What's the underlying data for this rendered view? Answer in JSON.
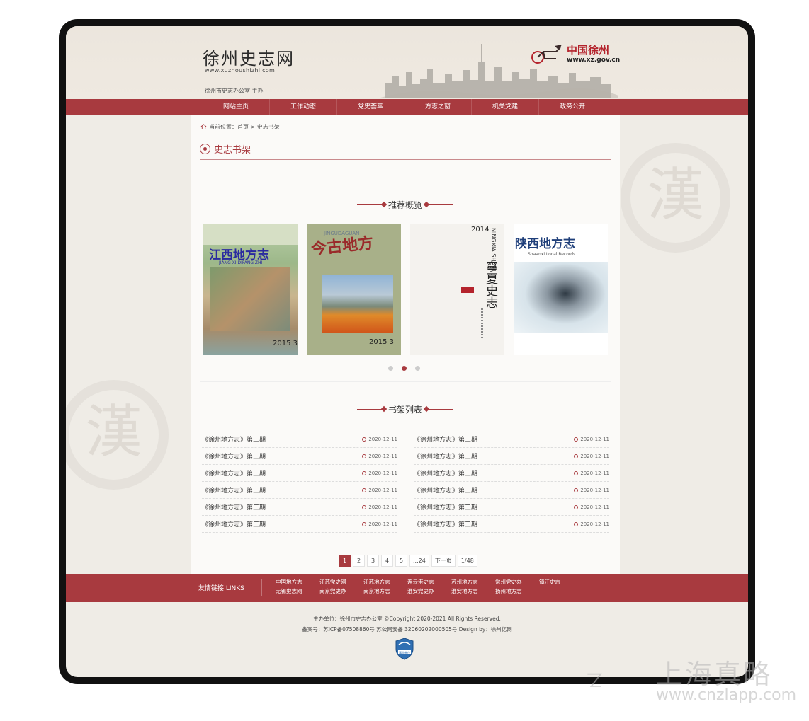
{
  "header": {
    "site_title": "徐州史志网",
    "site_url": "www.xuzhoushizhi.com",
    "host": "徐州市史志办公室 主办",
    "partner_title": "中国徐州",
    "partner_url": "www.xz.gov.cn"
  },
  "nav": [
    "网站主页",
    "工作动态",
    "党史荟萃",
    "方志之窗",
    "机关党建",
    "政务公开"
  ],
  "breadcrumb": "当前位置：首页 > 史志书架",
  "section_title": "史志书架",
  "recommend_heading": "推荐概览",
  "books": [
    {
      "title": "江西地方志",
      "subtitle": "JIANG XI DIFANG ZHI",
      "issue": "2015 3"
    },
    {
      "title": "今古地方",
      "subtitle": "JINGUDAGUAN",
      "issue": "2015 3"
    },
    {
      "title": "寧夏史志",
      "subtitle": "NINGXIA SHIZHI",
      "issue": "2014"
    },
    {
      "title": "陕西地方志",
      "subtitle": "Shaanxi Local Records",
      "issue": ""
    }
  ],
  "carousel": {
    "count": 3,
    "active": 1
  },
  "list_heading": "书架列表",
  "list_left": [
    {
      "title": "《徐州地方志》第三期",
      "date": "2020-12-11"
    },
    {
      "title": "《徐州地方志》第三期",
      "date": "2020-12-11"
    },
    {
      "title": "《徐州地方志》第三期",
      "date": "2020-12-11"
    },
    {
      "title": "《徐州地方志》第三期",
      "date": "2020-12-11"
    },
    {
      "title": "《徐州地方志》第三期",
      "date": "2020-12-11"
    },
    {
      "title": "《徐州地方志》第三期",
      "date": "2020-12-11"
    }
  ],
  "list_right": [
    {
      "title": "《徐州地方志》第三期",
      "date": "2020-12-11"
    },
    {
      "title": "《徐州地方志》第三期",
      "date": "2020-12-11"
    },
    {
      "title": "《徐州地方志》第三期",
      "date": "2020-12-11"
    },
    {
      "title": "《徐州地方志》第三期",
      "date": "2020-12-11"
    },
    {
      "title": "《徐州地方志》第三期",
      "date": "2020-12-11"
    },
    {
      "title": "《徐州地方志》第三期",
      "date": "2020-12-11"
    }
  ],
  "pager": [
    "1",
    "2",
    "3",
    "4",
    "5",
    "...24",
    "下一页",
    "1/48"
  ],
  "links_label": "友情链接 LINKS",
  "links": [
    "中国地方志",
    "江苏党史网",
    "江苏地方志",
    "连云港史志",
    "苏州地方志",
    "常州党史办",
    "镇江史志",
    "无锡史志网",
    "南京党史办",
    "南京地方志",
    "淮安党史办",
    "淮安地方志",
    "扬州地方志"
  ],
  "footer_line1": "主办单位：徐州市史志办公室 ©Copyright 2020-2021 All Rights Reserved.",
  "footer_line2": "备案号：苏ICP备07508860号 苏公网安备 32060202000505号 Design by：徐州亿网",
  "badge_text": "事业单位",
  "watermark": {
    "cn": "上海真略",
    "url": "www.cnzlapp.com"
  },
  "seal_char": "漢",
  "colors": {
    "brand": "#a83a3f",
    "background": "#efece6",
    "content": "#fbfaf8"
  }
}
